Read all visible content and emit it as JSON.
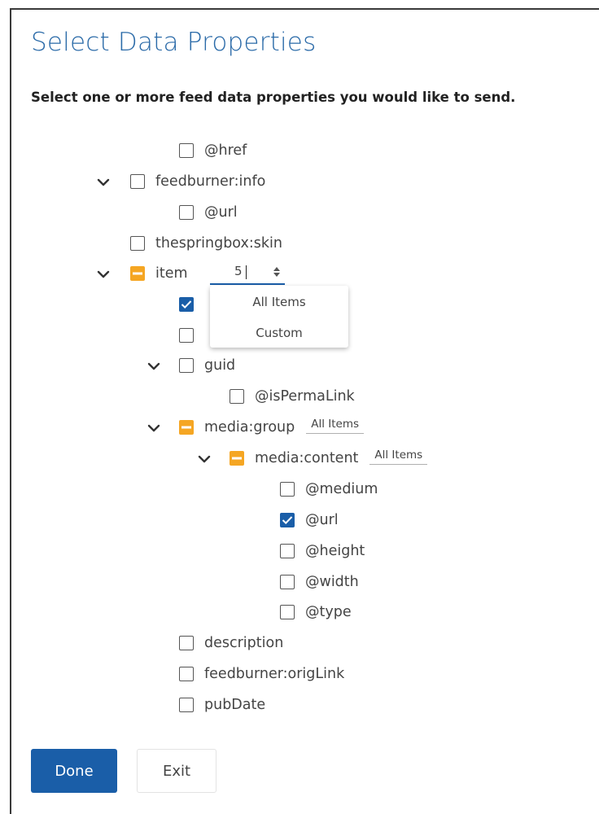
{
  "dialog": {
    "title": "Select Data Properties",
    "subtitle": "Select one or more feed data properties you would like to send."
  },
  "tree": [
    {
      "label": "@href",
      "state": "unchecked",
      "expandable": false
    },
    {
      "label": "feedburner:info",
      "state": "unchecked",
      "expandable": true
    },
    {
      "label": "@url",
      "state": "unchecked",
      "expandable": false
    },
    {
      "label": "thespringbox:skin",
      "state": "unchecked",
      "expandable": false
    },
    {
      "label": "item",
      "state": "partial",
      "expandable": true
    },
    {
      "label": "",
      "state": "checked",
      "expandable": false
    },
    {
      "label": "",
      "state": "unchecked",
      "expandable": false
    },
    {
      "label": "guid",
      "state": "unchecked",
      "expandable": true
    },
    {
      "label": "@isPermaLink",
      "state": "unchecked",
      "expandable": false
    },
    {
      "label": "media:group",
      "state": "partial",
      "expandable": true,
      "selector": "All Items"
    },
    {
      "label": "media:content",
      "state": "partial",
      "expandable": true,
      "selector": "All Items"
    },
    {
      "label": "@medium",
      "state": "unchecked",
      "expandable": false
    },
    {
      "label": "@url",
      "state": "checked",
      "expandable": false
    },
    {
      "label": "@height",
      "state": "unchecked",
      "expandable": false
    },
    {
      "label": "@width",
      "state": "unchecked",
      "expandable": false
    },
    {
      "label": "@type",
      "state": "unchecked",
      "expandable": false
    },
    {
      "label": "description",
      "state": "unchecked",
      "expandable": false
    },
    {
      "label": "feedburner:origLink",
      "state": "unchecked",
      "expandable": false
    },
    {
      "label": "pubDate",
      "state": "unchecked",
      "expandable": false
    }
  ],
  "item_count": {
    "value": "5"
  },
  "dropdown": {
    "options": [
      "All Items",
      "Custom"
    ]
  },
  "buttons": {
    "done_label": "Done",
    "exit_label": "Exit"
  },
  "colors": {
    "accent": "#1a5ea8",
    "title": "#2a6aa8",
    "partial": "#f5a623",
    "text": "#444444"
  },
  "icons": {
    "expand": "chevron-down-icon",
    "checked": "checkmark-icon",
    "partial": "minus-icon",
    "stepper": "up-down-stepper-icon"
  }
}
